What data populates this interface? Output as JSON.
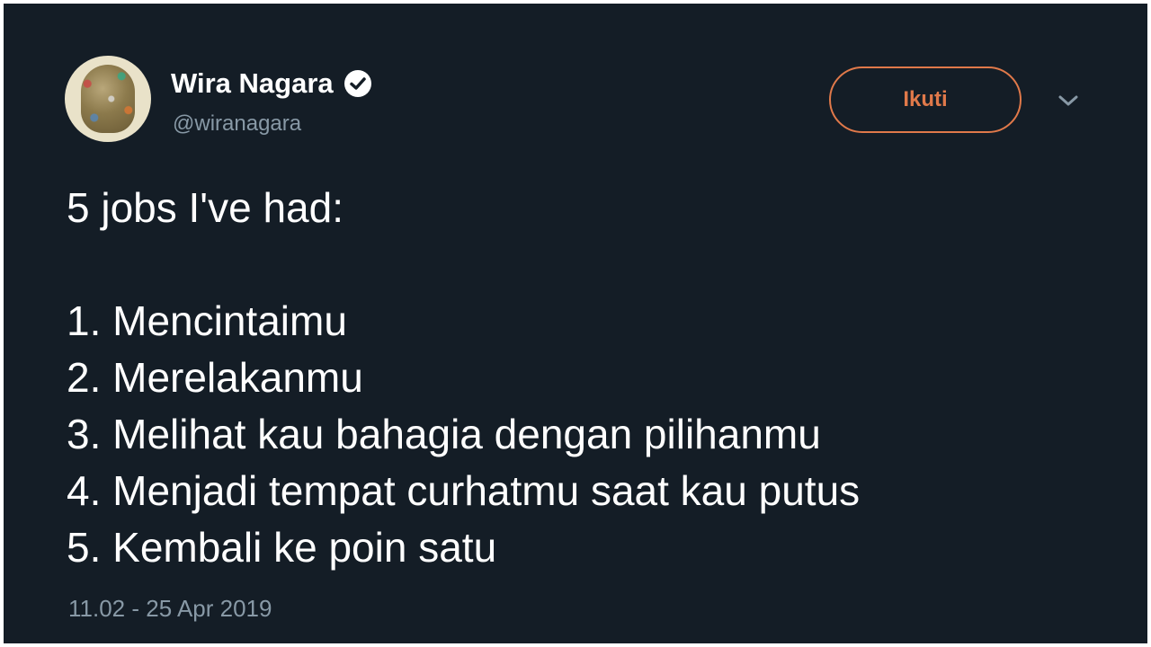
{
  "author": {
    "display_name": "Wira Nagara",
    "handle": "@wiranagara",
    "verified": true,
    "avatar_icon": "user-avatar"
  },
  "follow_button": {
    "label": "Ikuti",
    "color": "#e0794a"
  },
  "menu_icon": "chevron-down-icon",
  "tweet": {
    "intro": "5 jobs I've had:",
    "items": [
      "1. Mencintaimu",
      "2. Merelakanmu",
      "3. Melihat kau bahagia dengan pilihanmu",
      "4. Menjadi tempat curhatmu saat kau putus",
      "5. Kembali ke poin satu"
    ],
    "timestamp": "11.02 - 25 Apr 2019"
  },
  "colors": {
    "background": "#141d26",
    "text": "#ffffff",
    "muted": "#8899a6",
    "accent": "#e0794a"
  }
}
